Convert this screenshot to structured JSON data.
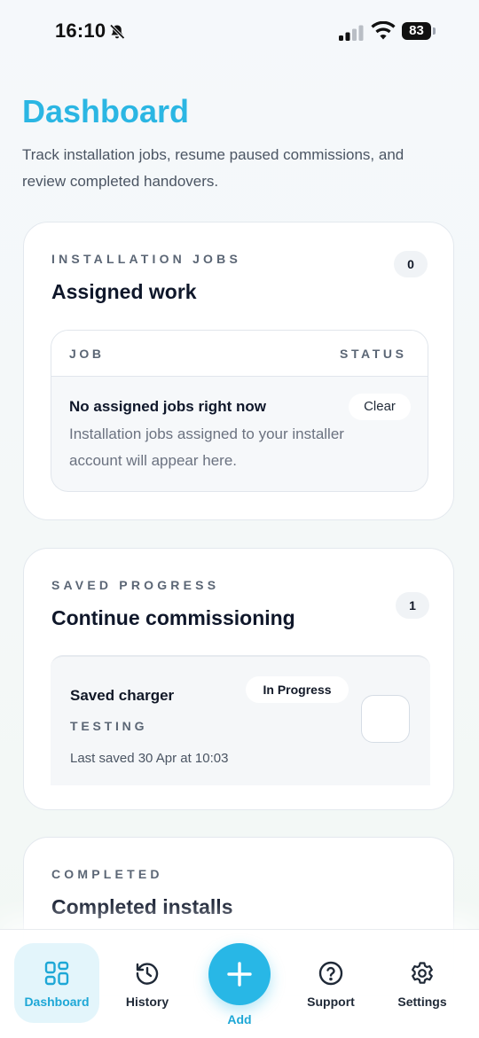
{
  "status_bar": {
    "time": "16:10",
    "battery": "83"
  },
  "header": {
    "title": "Dashboard",
    "subtitle": "Track installation jobs, resume paused commissions, and review completed handovers."
  },
  "installation_jobs": {
    "eyebrow": "INSTALLATION JOBS",
    "title": "Assigned work",
    "count": "0",
    "table": {
      "columns": [
        "JOB",
        "STATUS"
      ],
      "empty_title": "No assigned jobs right now",
      "empty_description": "Installation jobs assigned to your installer account will appear here.",
      "status_label": "Clear"
    }
  },
  "saved_progress": {
    "eyebrow": "SAVED PROGRESS",
    "title": "Continue commissioning",
    "count": "1",
    "items": [
      {
        "name": "Saved charger",
        "stage": "TESTING",
        "last_saved": "Last saved 30 Apr at 10:03",
        "status": "In Progress"
      }
    ]
  },
  "completed": {
    "eyebrow": "COMPLETED",
    "title": "Completed installs"
  },
  "bottom_nav": {
    "items": [
      {
        "label": "Dashboard",
        "icon": "grid-icon",
        "active": true
      },
      {
        "label": "History",
        "icon": "history-icon"
      },
      {
        "label": "Add",
        "icon": "plus-icon"
      },
      {
        "label": "Support",
        "icon": "help-circle-icon"
      },
      {
        "label": "Settings",
        "icon": "gear-icon"
      }
    ]
  },
  "colors": {
    "accent": "#28b7e6",
    "title": "#2bb6e3",
    "active_nav_bg": "#e3f5fb"
  }
}
